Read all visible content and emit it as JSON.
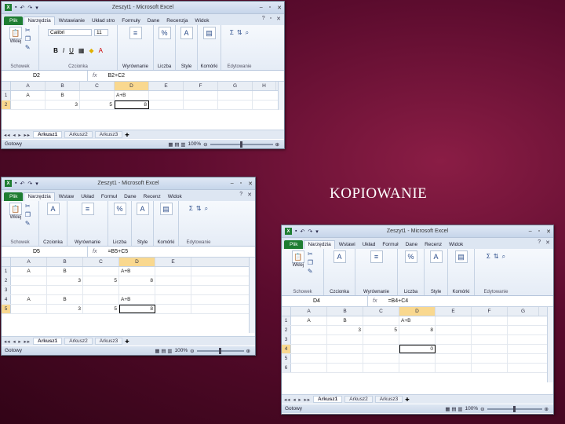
{
  "slide_title": "KOPIOWANIE",
  "window1": {
    "title": "Zeszyt1 - Microsoft Excel",
    "tabs": [
      "Plik",
      "Narzędzia",
      "Wstawianie",
      "Układ stro",
      "Formuły",
      "Dane",
      "Recenzja",
      "Widok"
    ],
    "ribbon": {
      "font_name": "Calibri",
      "font_size": "11",
      "clipboard": "Wklej",
      "clipboard_group": "Schowek",
      "font_group": "Czcionka",
      "align": "Wyrównanie",
      "number": "Liczba",
      "styles": "Style",
      "cells": "Komórki",
      "editing_group": "Edytowanie"
    },
    "name_box": "D2",
    "formula": "B2+C2",
    "columns": [
      "A",
      "B",
      "C",
      "D",
      "E",
      "F",
      "G",
      "H"
    ],
    "rows": [
      {
        "num": "1",
        "cells": [
          "A",
          "B",
          "",
          "A+B",
          "",
          "",
          "",
          ""
        ]
      },
      {
        "num": "2",
        "cells": [
          "",
          "3",
          "5",
          "8",
          "",
          "",
          "",
          ""
        ]
      }
    ],
    "sheet_tabs": [
      "Arkusz1",
      "Arkusz2",
      "Arkusz3"
    ],
    "status": "Gotowy",
    "zoom": "100%"
  },
  "window2": {
    "title": "Zeszyt1 - Microsoft Excel",
    "tabs": [
      "Plik",
      "Narzędzia",
      "Wstaw",
      "Układ",
      "Formuł",
      "Dane",
      "Recenz",
      "Widok"
    ],
    "ribbon": {
      "clipboard": "Wklej",
      "clipboard_group": "Schowek",
      "font": "Czcionka",
      "align": "Wyrównanie",
      "number": "Liczba",
      "styles": "Style",
      "cells": "Komórki",
      "editing_group": "Edytowanie"
    },
    "name_box": "D5",
    "formula": "=B5+C5",
    "columns": [
      "A",
      "B",
      "C",
      "D",
      "E"
    ],
    "rows": [
      {
        "num": "1",
        "cells": [
          "A",
          "B",
          "",
          "A+B",
          ""
        ]
      },
      {
        "num": "2",
        "cells": [
          "",
          "3",
          "5",
          "8",
          ""
        ]
      },
      {
        "num": "3",
        "cells": [
          "",
          "",
          "",
          "",
          ""
        ]
      },
      {
        "num": "4",
        "cells": [
          "A",
          "B",
          "",
          "A+B",
          ""
        ]
      },
      {
        "num": "5",
        "cells": [
          "",
          "3",
          "5",
          "8",
          ""
        ]
      }
    ],
    "sheet_tabs": [
      "Arkusz1",
      "Arkusz2",
      "Arkusz3"
    ],
    "status": "Gotowy",
    "zoom": "100%"
  },
  "window3": {
    "title": "Zeszyt1 - Microsoft Excel",
    "tabs": [
      "Plik",
      "Narzędzia",
      "Wstawi",
      "Układ",
      "Formuł",
      "Dane",
      "Recenz",
      "Widok"
    ],
    "ribbon": {
      "clipboard": "Wklej",
      "clipboard_group": "Schowek",
      "font": "Czcionka",
      "align": "Wyrównanie",
      "number": "Liczba",
      "styles": "Style",
      "cells": "Komórki",
      "editing_group": "Edytowanie"
    },
    "name_box": "D4",
    "formula": "=B4+C4",
    "columns": [
      "A",
      "B",
      "C",
      "D",
      "E",
      "F",
      "G"
    ],
    "rows": [
      {
        "num": "1",
        "cells": [
          "A",
          "B",
          "",
          "A+B",
          "",
          "",
          ""
        ]
      },
      {
        "num": "2",
        "cells": [
          "",
          "3",
          "5",
          "8",
          "",
          "",
          ""
        ]
      },
      {
        "num": "3",
        "cells": [
          "",
          "",
          "",
          "",
          "",
          "",
          ""
        ]
      },
      {
        "num": "4",
        "cells": [
          "",
          "",
          "",
          "0",
          "",
          "",
          ""
        ]
      },
      {
        "num": "5",
        "cells": [
          "",
          "",
          "",
          "",
          "",
          "",
          ""
        ]
      },
      {
        "num": "6",
        "cells": [
          "",
          "",
          "",
          "",
          "",
          "",
          ""
        ]
      }
    ],
    "sheet_tabs": [
      "Arkusz1",
      "Arkusz2",
      "Arkusz3"
    ],
    "status": "Gotowy",
    "zoom": "100%"
  }
}
